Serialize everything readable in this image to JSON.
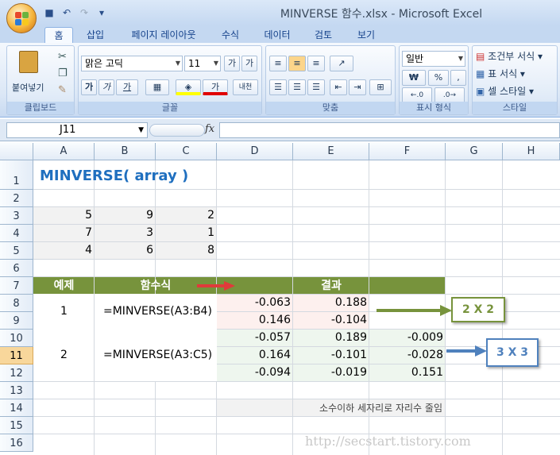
{
  "window": {
    "title": "MINVERSE 함수.xlsx - Microsoft Excel"
  },
  "tabs": [
    "홈",
    "삽입",
    "페이지 레이아웃",
    "수식",
    "데이터",
    "검토",
    "보기"
  ],
  "ribbon": {
    "clipboard": {
      "label": "클립보드",
      "paste": "붙여넣기"
    },
    "font": {
      "label": "글꼴",
      "font_name": "맑은 고딕",
      "font_size": "11",
      "bold": "가",
      "italic": "가",
      "underline": "가",
      "grow": "가",
      "wrap": "내천"
    },
    "align": {
      "label": "맞춤"
    },
    "number": {
      "label": "표시 형식",
      "format": "일반",
      "currency": "₩",
      "percent": "%",
      "comma": ","
    },
    "style": {
      "label": "스타일",
      "conditional": "조건부 서식",
      "table": "표 서식",
      "cell": "셀 스타일"
    }
  },
  "formula_bar": {
    "name_box": "J11",
    "fx": "fx",
    "formula": ""
  },
  "columns": [
    "A",
    "B",
    "C",
    "D",
    "E",
    "F",
    "G",
    "H"
  ],
  "rows": [
    "1",
    "2",
    "3",
    "4",
    "5",
    "6",
    "7",
    "8",
    "9",
    "10",
    "11",
    "12",
    "13",
    "14",
    "15",
    "16"
  ],
  "selected_row": "11",
  "sheet": {
    "title": "MINVERSE( array )",
    "matrix": [
      [
        "5",
        "9",
        "2"
      ],
      [
        "7",
        "3",
        "1"
      ],
      [
        "4",
        "6",
        "8"
      ]
    ],
    "header": {
      "example": "예제",
      "formula": "함수식",
      "result": "결과"
    },
    "ex1": {
      "no": "1",
      "formula": "=MINVERSE(A3:B4)",
      "values": [
        [
          "-0.063",
          "0.188"
        ],
        [
          "0.146",
          "-0.104"
        ]
      ],
      "callout": "2 X 2"
    },
    "ex2": {
      "no": "2",
      "formula": "=MINVERSE(A3:C5)",
      "values": [
        [
          "-0.057",
          "0.189",
          "-0.009"
        ],
        [
          "0.164",
          "-0.101",
          "-0.028"
        ],
        [
          "-0.094",
          "-0.019",
          "0.151"
        ]
      ],
      "callout": "3 X 3"
    },
    "note": "소수이하 세자리로 자리수 줄임",
    "watermark": "http://secstart.tistory.com"
  },
  "colors": {
    "header_green": "#77933c",
    "callout_green": "#77933c",
    "callout_blue": "#4f81bd",
    "arrow_red": "#e03a3a",
    "pink": "#fdf0ee",
    "mint": "#eef6ee",
    "gray_fill": "#f2f2f2",
    "title_blue": "#1f6fbf"
  }
}
